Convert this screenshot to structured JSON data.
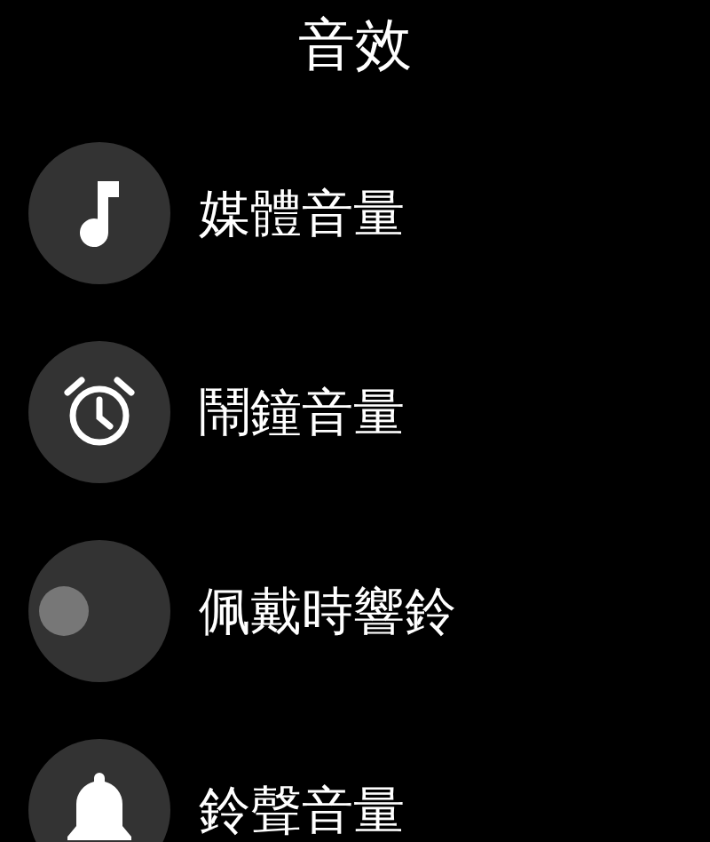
{
  "title": "音效",
  "items": [
    {
      "kind": "music",
      "label": "媒體音量"
    },
    {
      "kind": "alarm",
      "label": "鬧鐘音量"
    },
    {
      "kind": "toggle",
      "label": "佩戴時響鈴",
      "on": false
    },
    {
      "kind": "bell",
      "label": "鈴聲音量"
    }
  ]
}
